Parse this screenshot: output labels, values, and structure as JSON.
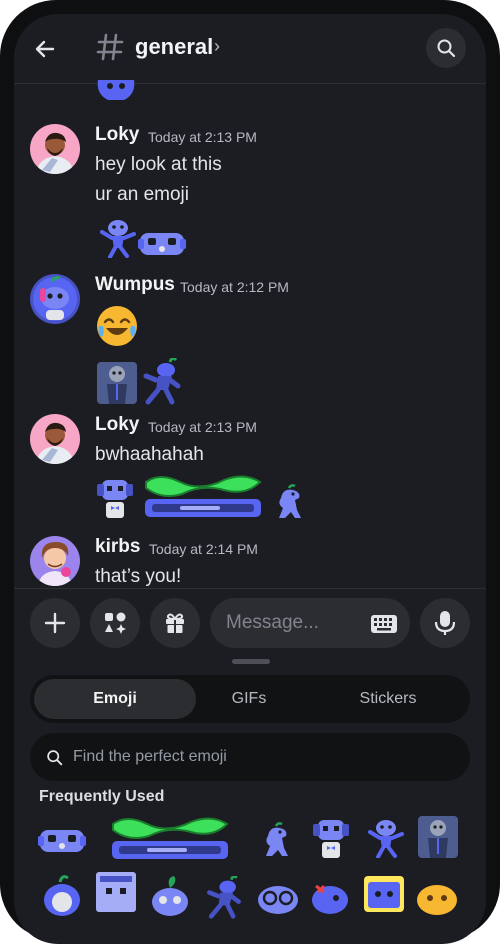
{
  "header": {
    "channel_name": "general",
    "chevron": "›",
    "icons": [
      "arrow-left-icon",
      "hash-icon",
      "search-icon"
    ]
  },
  "messages": [
    {
      "author": "Loky",
      "time": "Today at 2:13 PM",
      "lines": [
        "hey look at this",
        "ur an emoji"
      ]
    },
    {
      "author": "Wumpus",
      "time": "Today at 2:12 PM",
      "lines": []
    },
    {
      "author": "Loky",
      "time": "Today at 2:13 PM",
      "lines": [
        "bwhaahahah"
      ]
    },
    {
      "author": "kirbs",
      "time": "Today at 2:14 PM",
      "lines": [
        "that’s you!"
      ]
    }
  ],
  "composer": {
    "placeholder": "Message...",
    "icons": [
      "plus-icon",
      "apps-icon",
      "gift-icon",
      "keyboard-icon",
      "microphone-icon"
    ]
  },
  "picker": {
    "tabs": [
      "Emoji",
      "GIFs",
      "Stickers"
    ],
    "active_tab": "Emoji",
    "search_placeholder": "Find the perfect emoji",
    "section_title": "Frequently Used"
  },
  "colors": {
    "background": "#1c1d22",
    "input": "#2b2d31",
    "wumpus_blue": "#5865f2",
    "accent_green": "#23a55a",
    "text": "#f2f3f5",
    "muted": "#b5bac1"
  }
}
